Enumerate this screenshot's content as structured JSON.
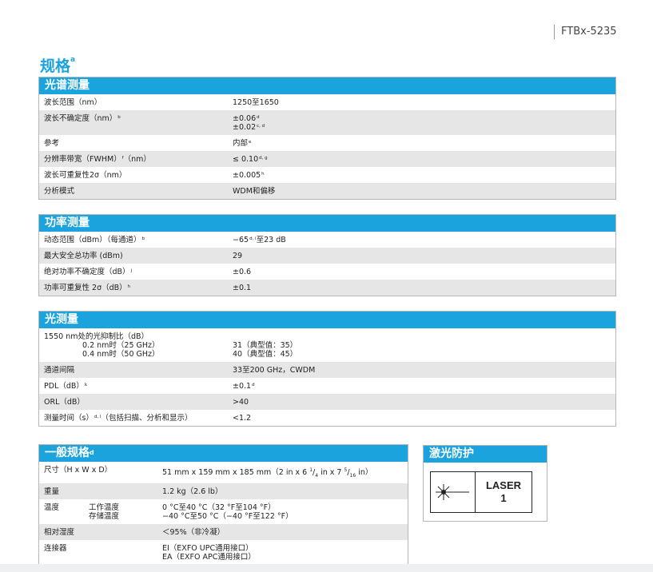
{
  "header": {
    "model": "FTBx-5235"
  },
  "page_heading": {
    "title": "规格",
    "note": "a"
  },
  "spectral": {
    "title": "光谱测量",
    "rows": [
      {
        "label": "波长范围（nm）",
        "value": "1250至1650"
      },
      {
        "label": "波长不确定度（nm）",
        "label_note": "b",
        "value1": "±0.06",
        "note1": "d",
        "value2": "±0.02",
        "note2": "c, d"
      },
      {
        "label": "参考",
        "value": "内部",
        "note": "e"
      },
      {
        "label": "分辨率带宽（FWHM）",
        "label_note": "f",
        "label_tail": "（nm）",
        "value": "≤ 0.10",
        "note": "d, g"
      },
      {
        "label": "波长可重复性2σ（nm）",
        "value": "±0.005",
        "note": "h"
      },
      {
        "label": "分析模式",
        "value": "WDM和偏移"
      }
    ]
  },
  "power": {
    "title": "功率测量",
    "rows": [
      {
        "label": "动态范围（dBm）（每通道）",
        "label_note": "b",
        "value_a": "−65",
        "note": "d, i",
        "value_b": "至23 dB"
      },
      {
        "label": "最大安全总功率 (dBm)",
        "value": "29"
      },
      {
        "label": "绝对功率不确定度（dB）",
        "label_note": "j",
        "value": "±0.6"
      },
      {
        "label": "功率可重复性 2σ（dB）",
        "label_note": "h",
        "value": "±0.1"
      }
    ]
  },
  "optical": {
    "title": "光测量",
    "rows": [
      {
        "label": "1550 nm处的光抑制比（dB）",
        "sub1": "0.2 nm时（25 GHz）",
        "value1": "31（典型值：35）",
        "sub2": "0.4 nm时（50 GHz）",
        "value2": "40（典型值：45）"
      },
      {
        "label": "通道间隔",
        "value": "33至200 GHz，CWDM"
      },
      {
        "label": "PDL（dB）",
        "label_note": "k",
        "value": "±0.1",
        "note": "d"
      },
      {
        "label": "ORL（dB）",
        "value": ">40"
      },
      {
        "label": "测量时间（s）",
        "label_note": "d, l",
        "label_tail": "（包括扫描、分析和显示）",
        "value": "<1.2"
      }
    ]
  },
  "general": {
    "title": "一般规格",
    "note": "d",
    "rows": [
      {
        "label": "尺寸（H x W x D）",
        "value_a": "51 mm x 159 mm x 185 mm（2 in x 6 ",
        "frac1_num": "1",
        "frac1_den": "4",
        "value_b": " in x 7 ",
        "frac2_num": "5",
        "frac2_den": "16",
        "value_c": " in）"
      },
      {
        "label": "重量",
        "value": "1.2 kg（2.6 lb）"
      },
      {
        "label": "温度",
        "sub1": "工作温度",
        "value1": "0 °C至40 °C（32 °F至104 °F）",
        "sub2": "存储温度",
        "value2": "−40 °C至50 °C（−40 °F至122 °F）"
      },
      {
        "label": "相对湿度",
        "value": "＜95%（非冷凝）"
      },
      {
        "label": "连接器",
        "value1": "EI（EXFO UPC通用接口）",
        "value2": "EA（EXFO APC通用接口）"
      }
    ]
  },
  "laser": {
    "title": "激光防护",
    "line1": "LASER",
    "line2": "1",
    "icon": "laser-warning-icon"
  }
}
